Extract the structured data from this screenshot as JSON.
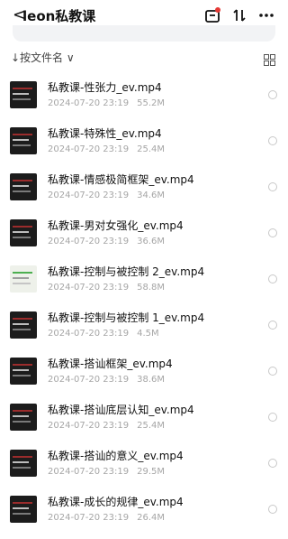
{
  "header": {
    "back_glyph": "<",
    "title": "leon私教课"
  },
  "sort": {
    "label": "↓按文件名 ∨"
  },
  "files": [
    {
      "name": "私教课-性张力_ev.mp4",
      "date": "2024-07-20 23:19",
      "size": "55.2M",
      "thumb": "dark"
    },
    {
      "name": "私教课-特殊性_ev.mp4",
      "date": "2024-07-20 23:19",
      "size": "25.4M",
      "thumb": "dark"
    },
    {
      "name": "私教课-情感极简框架_ev.mp4",
      "date": "2024-07-20 23:19",
      "size": "34.6M",
      "thumb": "dark"
    },
    {
      "name": "私教课-男对女强化_ev.mp4",
      "date": "2024-07-20 23:19",
      "size": "36.6M",
      "thumb": "dark"
    },
    {
      "name": "私教课-控制与被控制 2_ev.mp4",
      "date": "2024-07-20 23:19",
      "size": "58.8M",
      "thumb": "light"
    },
    {
      "name": "私教课-控制与被控制 1_ev.mp4",
      "date": "2024-07-20 23:19",
      "size": "4.5M",
      "thumb": "dark"
    },
    {
      "name": "私教课-搭讪框架_ev.mp4",
      "date": "2024-07-20 23:19",
      "size": "38.6M",
      "thumb": "dark"
    },
    {
      "name": "私教课-搭讪底层认知_ev.mp4",
      "date": "2024-07-20 23:19",
      "size": "25.4M",
      "thumb": "dark"
    },
    {
      "name": "私教课-搭讪的意义_ev.mp4",
      "date": "2024-07-20 23:19",
      "size": "29.5M",
      "thumb": "dark"
    },
    {
      "name": "私教课-成长的规律_ev.mp4",
      "date": "2024-07-20 23:19",
      "size": "26.4M",
      "thumb": "dark"
    }
  ]
}
